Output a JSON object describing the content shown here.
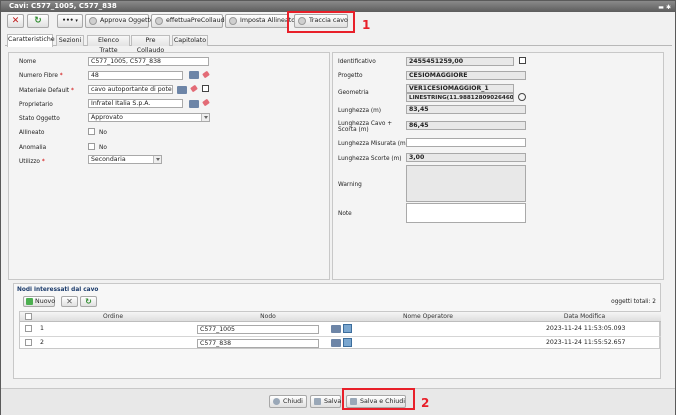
{
  "window": {
    "title": "Cavi: C577_1005, C577_838"
  },
  "toolbar": {
    "dots_label": "•••",
    "approva_label": "Approva Oggetto",
    "precollaudo_label": "effettuaPreCollaudo",
    "allineato_label": "Imposta Allineato",
    "traccia_label": "Traccia cavo"
  },
  "callouts": {
    "one": "1",
    "two": "2"
  },
  "tabs": [
    "Caratteristiche",
    "Sezioni",
    "Elenco Tratte",
    "Pre Collaudo",
    "Capitolato"
  ],
  "left_form": {
    "nome_label": "Nome",
    "nome_value": "C577_1005, C577_838",
    "numero_fibre_label": "Numero Fibre",
    "numero_fibre_value": "48",
    "materiale_label": "Materiale Default",
    "materiale_value": "cavo autoportante di potenzia",
    "proprietario_label": "Proprietario",
    "proprietario_value": "Infratel Italia S.p.A.",
    "stato_label": "Stato Oggetto",
    "stato_value": "Approvato",
    "allineato_label": "Allineato",
    "allineato_value": "No",
    "anomalia_label": "Anomalia",
    "anomalia_value": "No",
    "utilizzo_label": "Utilizzo",
    "utilizzo_value": "Secondaria",
    "required_mark": "*"
  },
  "right_form": {
    "identificativo_label": "Identificativo",
    "identificativo_value": "2455451259,00",
    "progetto_label": "Progetto",
    "progetto_value": "CESIOMAGGIORE",
    "geometria_label": "Geometria",
    "geometria_value_1": "VER1CESIOMAGGIOR_1",
    "geometria_value_2": "LINESTRING(11.988128090264608 46.0",
    "lunghezza_label": "Lunghezza (m)",
    "lunghezza_value": "83,45",
    "lunghezza_scorta_label": "Lunghezza Cavo + Scorta (m)",
    "lunghezza_scorta_value": "86,45",
    "lunghezza_misurata_label": "Lunghezza Misurata (m)",
    "lunghezza_misurata_value": "",
    "lunghezza_scorte_label": "Lunghezza Scorte (m)",
    "lunghezza_scorte_value": "3,00",
    "warning_label": "Warning",
    "note_label": "Note"
  },
  "nodes": {
    "title": "Nodi interessati dal cavo",
    "nuovo_label": "Nuovo",
    "total_label": "oggetti totali: 2",
    "columns": [
      "Ordine",
      "Nodo",
      "Nome Operatore",
      "Data Modifica"
    ],
    "rows": [
      {
        "ordine": "1",
        "nodo": "C577_1005",
        "operatore": "",
        "data": "2023-11-24 11:53:05.093"
      },
      {
        "ordine": "2",
        "nodo": "C577_838",
        "operatore": "",
        "data": "2023-11-24 11:55:52.657"
      }
    ]
  },
  "footer": {
    "chiudi_label": "Chiudi",
    "salva_label": "Salva",
    "salva_chiudi_label": "Salva e Chiudi"
  },
  "colors": {
    "callout": "#e8202a",
    "required": "#d00000",
    "title_bar": "#6e6e6e"
  },
  "icons": [
    "close-icon",
    "refresh-icon",
    "keyboard-icon",
    "eraser-icon",
    "external-link-icon",
    "add-icon",
    "delete-icon",
    "save-icon"
  ]
}
